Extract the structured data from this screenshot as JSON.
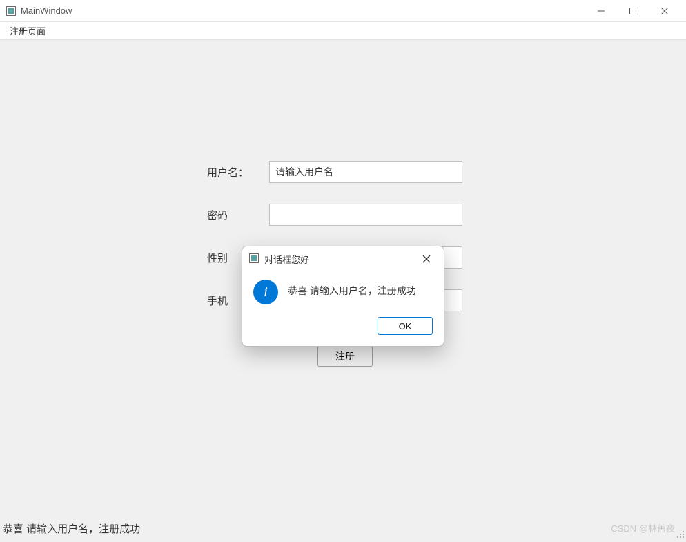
{
  "window": {
    "title": "MainWindow",
    "controls": {
      "minimize": "—",
      "maximize": "☐",
      "close": "✕"
    }
  },
  "menubar": {
    "register_page": "注册页面"
  },
  "form": {
    "username_label": "用户名：",
    "username_value": "请输入用户名",
    "password_label": "密码",
    "gender_label": "性别",
    "phone_label": "手机",
    "register_button": "注册"
  },
  "dialog": {
    "title": "对话框您好",
    "message": "恭喜 请输入用户名，注册成功",
    "ok_button": "OK",
    "info_glyph": "i"
  },
  "status": {
    "text": "恭喜 请输入用户名，注册成功"
  },
  "watermark": "CSDN @林苒夜"
}
